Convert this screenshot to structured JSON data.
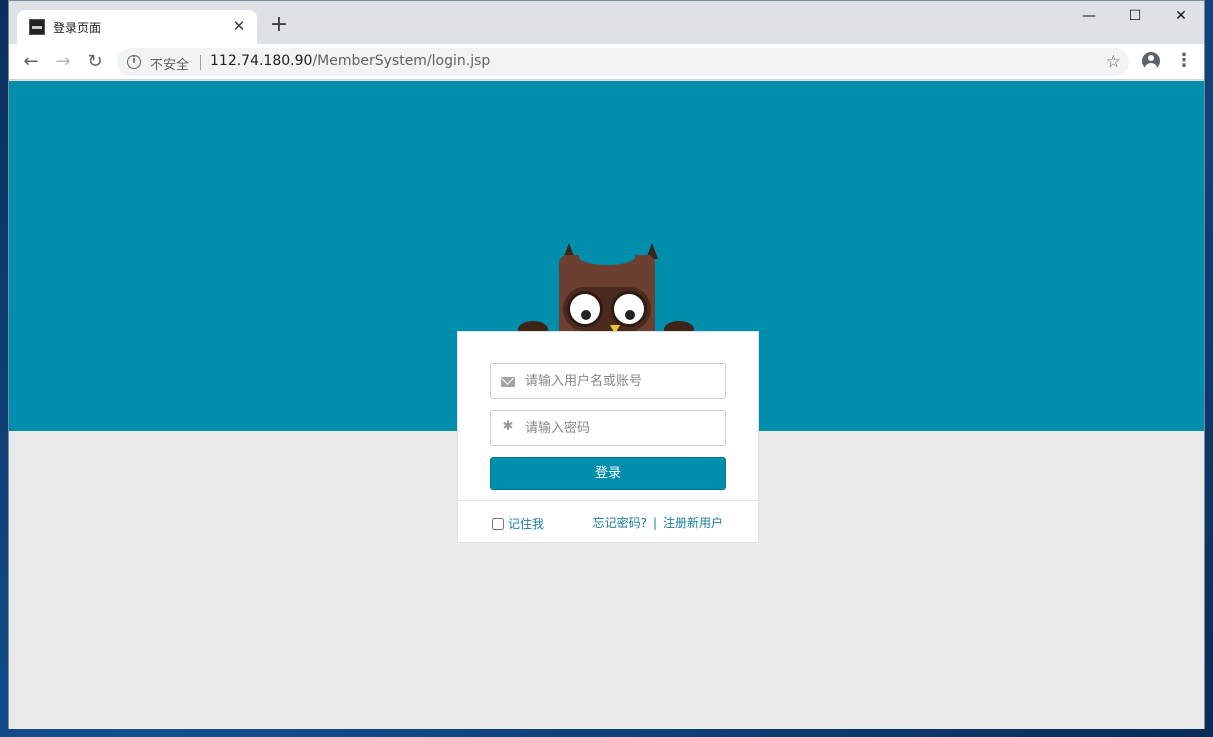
{
  "browser": {
    "tab_title": "登录页面",
    "tab_close": "✕",
    "new_tab": "+",
    "window_controls": {
      "minimize": "—",
      "maximize": "☐",
      "close": "✕"
    },
    "nav": {
      "back": "←",
      "forward": "→",
      "reload": "↻"
    },
    "security_label": "不安全",
    "url_host": "112.74.180.90",
    "url_path": "/MemberSystem/login.jsp",
    "star": "☆",
    "menu": "⋮"
  },
  "login": {
    "username_placeholder": "请输入用户名或账号",
    "password_placeholder": "请输入密码",
    "password_icon": "✱",
    "submit_label": "登录",
    "remember_label": "记住我",
    "forgot_label": "忘记密码?",
    "separator": "|",
    "register_label": "注册新用户"
  },
  "colors": {
    "banner": "#008ead",
    "page_background": "#eaeaea",
    "button": "#008ead",
    "link": "#1a7fa0"
  },
  "icons": [
    "info-icon",
    "star-icon",
    "profile-icon",
    "menu-icon",
    "envelope-icon",
    "asterisk-icon",
    "owl-mascot"
  ]
}
